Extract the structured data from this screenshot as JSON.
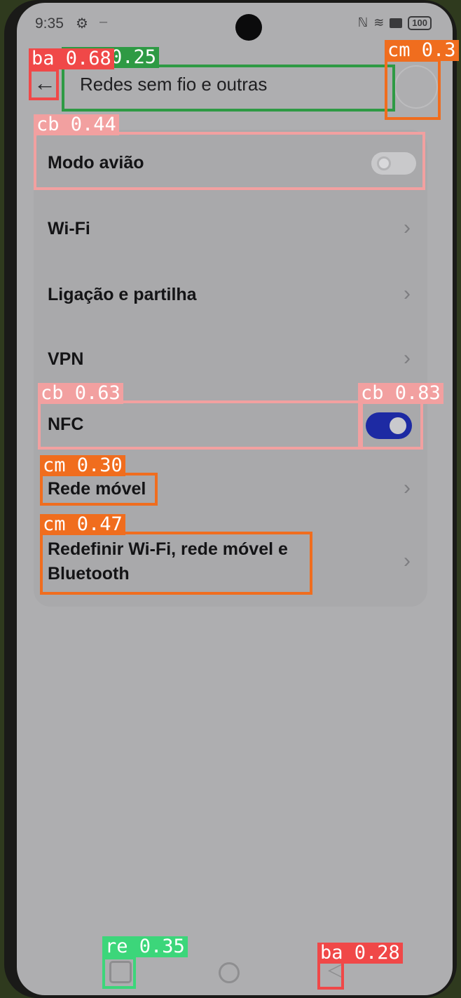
{
  "status_bar": {
    "time": "9:35",
    "settings_glyph": "⚙",
    "dash": "–",
    "nfc_glyph": "ℕ",
    "wifi_glyph": "≋",
    "battery": "100"
  },
  "header": {
    "back_glyph": "←",
    "title": "Redes sem fio e outras"
  },
  "rows": {
    "airplane": "Modo avião",
    "wifi": "Wi-Fi",
    "tethering": "Ligação e partilha",
    "vpn": "VPN",
    "nfc": "NFC",
    "mobile": "Rede móvel",
    "reset_1": "Redefinir Wi-Fi, rede móvel e",
    "reset_2": "Bluetooth"
  },
  "chevron": "›",
  "toggles": {
    "airplane_on": false,
    "nfc_on": true
  },
  "nav": {
    "back_glyph": "◁"
  },
  "detections": {
    "ba_back": "ba 0.68",
    "title_box": "0.25",
    "cm_top": "cm 0.3",
    "cb_airplane": "cb 0.44",
    "cb_nfc_row": "cb 0.63",
    "cb_nfc_toggle": "cb 0.83",
    "cm_mobile": "cm 0.30",
    "cm_reset": "cm 0.47",
    "re_nav": "re 0.35",
    "ba_nav": "ba 0.28"
  },
  "colors": {
    "red": "#f04848",
    "green": "#2e9a44",
    "orange": "#f06d1e",
    "pink": "#f2a0a0",
    "mint": "#3cd67a",
    "toggle_on": "#1d2aa3"
  }
}
